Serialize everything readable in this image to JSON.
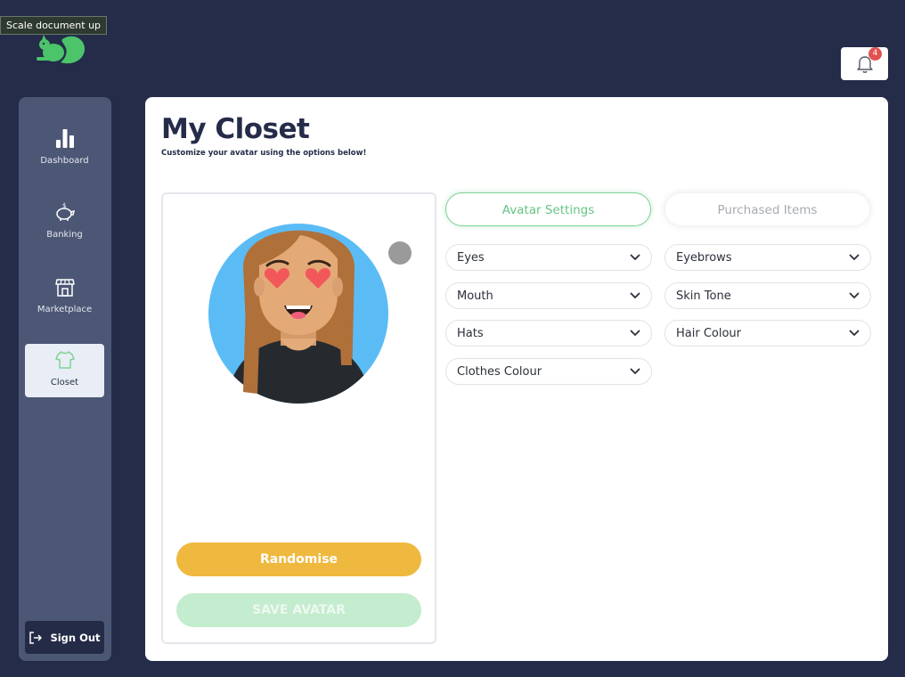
{
  "tooltip": {
    "text": "Scale document up"
  },
  "header": {
    "notifications_count": "4",
    "logo_icon": "squirrel-logo",
    "bell_icon": "bell-icon"
  },
  "sidebar": {
    "items": [
      {
        "label": "Dashboard",
        "icon": "bar-chart-icon"
      },
      {
        "label": "Banking",
        "icon": "piggy-bank-icon"
      },
      {
        "label": "Marketplace",
        "icon": "storefront-icon"
      },
      {
        "label": "Closet",
        "icon": "shirt-icon",
        "active": true
      }
    ],
    "signout_label": "Sign Out"
  },
  "main": {
    "title": "My Closet",
    "subtitle": "Customize your avatar using the options below!"
  },
  "avatar_card": {
    "randomise_label": "Randomise",
    "save_label": "SAVE AVATAR"
  },
  "tabs": [
    {
      "label": "Avatar Settings",
      "active": true
    },
    {
      "label": "Purchased Items",
      "active": false
    }
  ],
  "options": [
    {
      "label": "Eyes"
    },
    {
      "label": "Eyebrows"
    },
    {
      "label": "Mouth"
    },
    {
      "label": "Skin Tone"
    },
    {
      "label": "Hats"
    },
    {
      "label": "Hair Colour"
    },
    {
      "label": "Clothes Colour"
    }
  ],
  "colors": {
    "background": "#242c49",
    "sidebar": "#4c5775",
    "accent_green": "#7fd396",
    "randomise_yellow": "#efb93f",
    "badge_red": "#e0524f"
  }
}
